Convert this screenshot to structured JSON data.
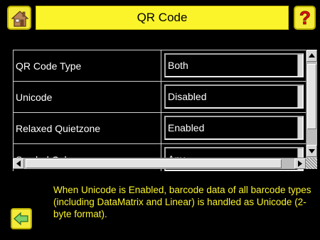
{
  "header": {
    "title": "QR Code",
    "home_icon": "home-icon",
    "help_icon": "help-icon"
  },
  "settings": [
    {
      "label": "QR Code Type",
      "value": "Both"
    },
    {
      "label": "Unicode",
      "value": "Disabled"
    },
    {
      "label": "Relaxed Quietzone",
      "value": "Enabled"
    },
    {
      "label": "Symbol Color",
      "value": "Any"
    }
  ],
  "help": {
    "text": "When Unicode is Enabled, barcode data of all barcode types (including DataMatrix and Linear) is handled as Unicode (2-byte format)."
  },
  "footer": {
    "back_icon": "back-arrow-icon"
  },
  "colors": {
    "accent": "#fbf42a",
    "background": "#000000"
  }
}
